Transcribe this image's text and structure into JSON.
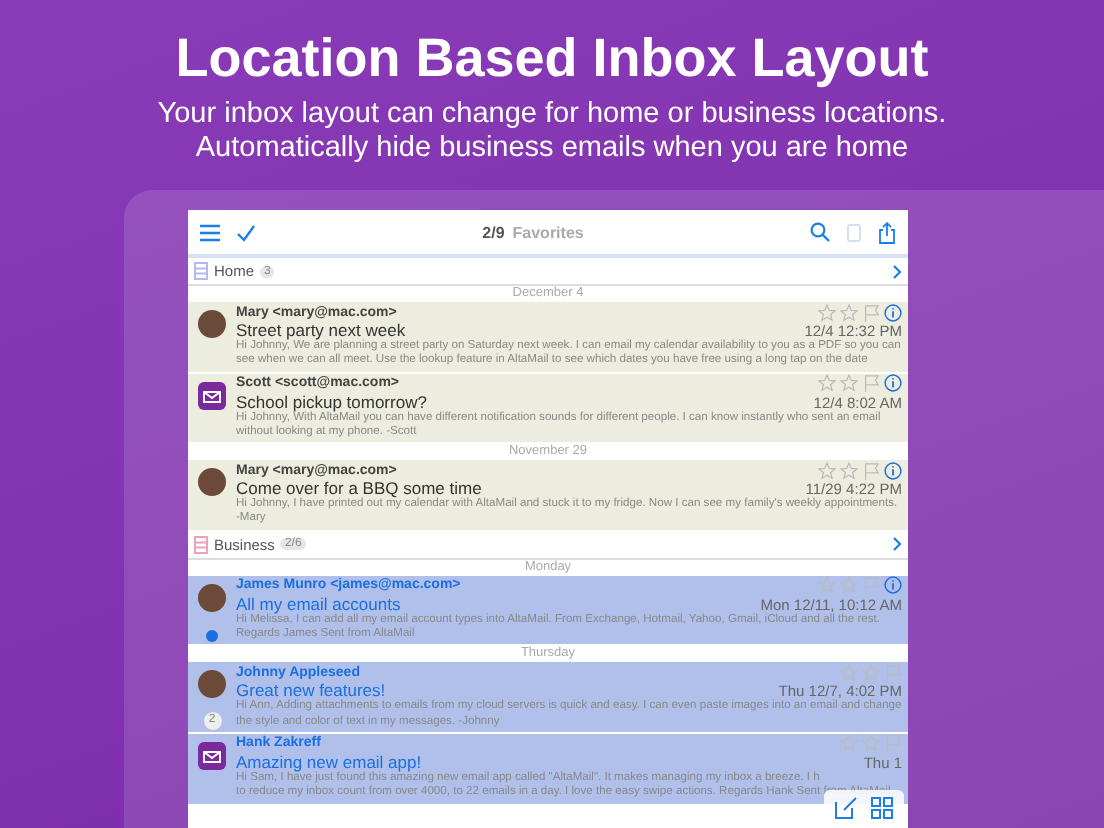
{
  "headline": "Location Based Inbox Layout",
  "subtitle": "Your inbox layout can change for home or business locations. Automatically hide business emails when you are home",
  "toolbar": {
    "count": "2/9",
    "title": "Favorites",
    "trash_disabled": true
  },
  "sections": [
    {
      "name": "Home",
      "count": "3",
      "kind": "home",
      "groups": [
        {
          "date": "December 4",
          "emails": [
            {
              "kind": "person",
              "sender": "Mary <mary@mac.com>",
              "subject": "Street party next week",
              "date": "12/4 12:32 PM",
              "preview": "Hi Johnny, We are planning a street party on Saturday next week. I can email my calendar availability to you as a PDF so you can see when we can all meet. Use the lookup feature in AltaMail to see which dates you have free using a long tap on the date",
              "info": true,
              "unread": false
            },
            {
              "kind": "app",
              "sender": "Scott <scott@mac.com>",
              "subject": "School pickup tomorrow?",
              "date": "12/4 8:02 AM",
              "preview": "Hi Johnny, With AltaMail you can have different notification sounds for different people. I can know instantly who sent an email without looking at my phone. -Scott",
              "info": true,
              "unread": false
            }
          ]
        },
        {
          "date": "November 29",
          "emails": [
            {
              "kind": "person",
              "sender": "Mary <mary@mac.com>",
              "subject": "Come over for a BBQ some time",
              "date": "11/29 4:22 PM",
              "preview": "Hi Johnny, I have printed out my calendar with AltaMail and stuck it to my fridge. Now I can see my family's weekly appointments. -Mary",
              "info": true,
              "unread": false
            }
          ]
        }
      ]
    },
    {
      "name": "Business",
      "count": "2/6",
      "kind": "business",
      "groups": [
        {
          "date": "Monday",
          "emails": [
            {
              "kind": "person",
              "sender": "James Munro <james@mac.com>",
              "subject": "All my email accounts",
              "date": "Mon 12/11, 10:12 AM",
              "preview": "Hi Melissa, I can add all my email account types into AltaMail. From Exchange, Hotmail, Yahoo, Gmail, iCloud and all the rest. Regards James Sent from AltaMail",
              "info": true,
              "unread": true
            }
          ]
        },
        {
          "date": "Thursday",
          "emails": [
            {
              "kind": "person",
              "sender": "Johnny Appleseed",
              "subject": "Great new features!",
              "date": "Thu 12/7, 4:02 PM",
              "preview": "Hi Ann, Adding attachments to emails from my cloud servers is quick and easy. I can even paste images into an email and change the style and color of text in my messages. -Johnny",
              "info": false,
              "unread": false,
              "thread": "2"
            },
            {
              "kind": "app",
              "sender": "Hank Zakreff",
              "subject": "Amazing new email app!",
              "date": "Thu 1",
              "preview": "Hi Sam, I have just found this amazing new email app called \"AltaMail\". It makes managing my inbox a breeze. I h",
              "preview_2": "to reduce my inbox count from over 4000, to 22 emails in a day. I love the easy swipe actions. Regards Hank Sent from AltaMail",
              "info": false,
              "unread": false
            }
          ]
        }
      ]
    }
  ]
}
